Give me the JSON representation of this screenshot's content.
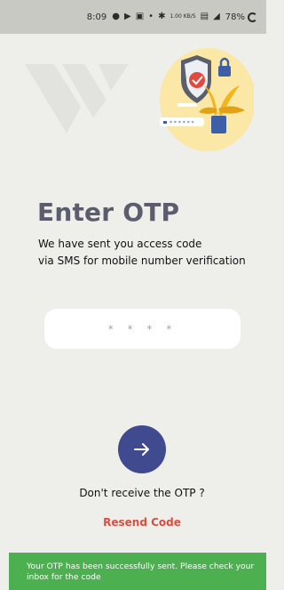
{
  "status_bar": {
    "time": "8:09",
    "network_speed": "1.00 KB/S",
    "battery": "78%"
  },
  "otp": {
    "title": "Enter OTP",
    "subtitle_line1": "We have sent you access code",
    "subtitle_line2": "via SMS for mobile number verification",
    "input_placeholder": "* * * *",
    "no_otp_text": "Don't receive the OTP ?",
    "resend_label": "Resend Code"
  },
  "illustration": {
    "password_mask": "* * * * * *"
  },
  "toast": {
    "message": "Your OTP has been successfully sent. Please check your inbox for the code"
  },
  "colors": {
    "background": "#eeeeea",
    "primary_button": "#3f4a8f",
    "resend_link": "#e14a3c",
    "toast": "#4caf50"
  }
}
